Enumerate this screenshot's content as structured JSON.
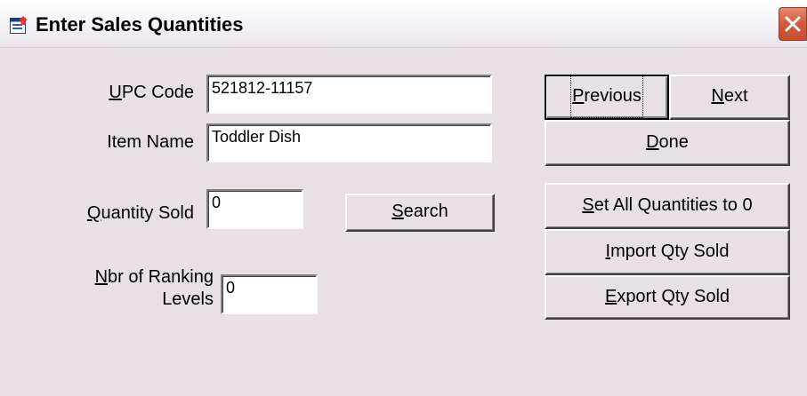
{
  "window": {
    "title": "Enter Sales Quantities",
    "icon": "form-window-icon",
    "close_icon": "close-icon",
    "close_color": "#d25a3a"
  },
  "form": {
    "upc_label_mnemonic": "U",
    "upc_label_rest": "PC Code",
    "upc_value": "521812-11157",
    "item_name_label": "Item Name",
    "item_name_value": "Toddler Dish",
    "quantity_label_mnemonic": "Q",
    "quantity_label_rest": "uantity Sold",
    "quantity_value": "0",
    "ranking_label_line1_mnemonic": "N",
    "ranking_label_line1_rest": "br of Ranking",
    "ranking_label_line2": "Levels",
    "ranking_value": "0"
  },
  "buttons": {
    "search": {
      "mnemonic": "S",
      "rest": "earch"
    },
    "previous": {
      "mnemonic": "P",
      "rest": "revious"
    },
    "next": {
      "mnemonic": "N",
      "rest": "ext"
    },
    "done": {
      "mnemonic": "D",
      "rest": "one"
    },
    "set_all": {
      "mnemonic": "S",
      "rest": "et All Quantities to 0"
    },
    "import": {
      "mnemonic": "I",
      "rest": "mport Qty Sold"
    },
    "export": {
      "mnemonic": "E",
      "rest": "xport Qty Sold"
    }
  }
}
